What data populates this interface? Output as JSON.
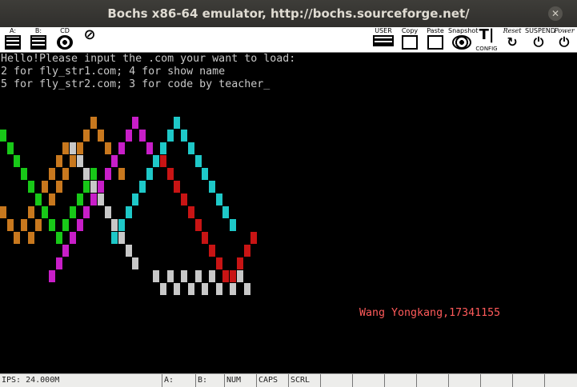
{
  "window": {
    "title": "Bochs x86-64 emulator, http://bochs.sourceforge.net/"
  },
  "toolbar": {
    "floppy_a": "A:",
    "floppy_b": "B:",
    "cdrom": "CD",
    "user": "USER",
    "copy": "Copy",
    "paste": "Paste",
    "snapshot": "Snapshot",
    "config": "CONFIG",
    "reset": "Reset",
    "suspend": "SUSPEND",
    "power": "Power"
  },
  "console": {
    "lines": [
      "Hello!Please input the .com your want to load:",
      "2 for fly_str1.com; 4 for show name",
      "5 for fly_str2.com; 3 for code by teacher"
    ],
    "cursor": "_",
    "signature": "Wang Yongkang,17341155"
  },
  "colors": {
    "text": "#c8c8c8",
    "signature": "#ff5a5a",
    "orange": "#c8781e",
    "green": "#18c818",
    "gray": "#c8c8c8",
    "magenta": "#c81ec8",
    "cyan": "#1ec8c8",
    "red": "#c81414"
  },
  "statusbar": {
    "ips": "IPS: 24.000M",
    "a": "A:",
    "b": "B:",
    "num": "NUM",
    "caps": "CAPS",
    "scrl": "SCRL"
  }
}
